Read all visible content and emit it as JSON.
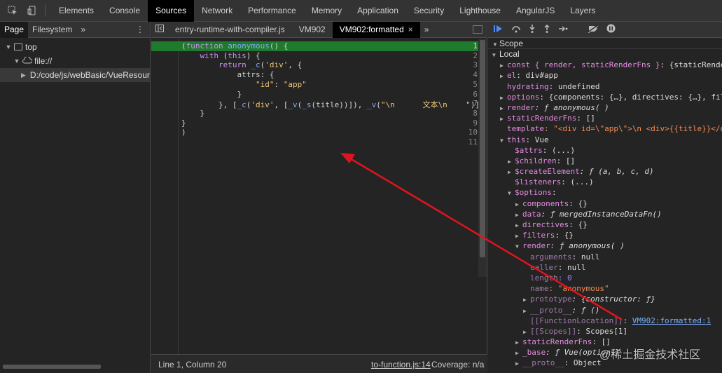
{
  "top_tabs": [
    "Elements",
    "Console",
    "Sources",
    "Network",
    "Performance",
    "Memory",
    "Application",
    "Security",
    "Lighthouse",
    "AngularJS",
    "Layers"
  ],
  "active_top_tab": "Sources",
  "navigator": {
    "tabs": [
      "Page",
      "Filesystem"
    ],
    "more": "»",
    "menu": "⋮",
    "tree": [
      {
        "label": "top",
        "arrow": "▼"
      },
      {
        "label": "file://",
        "arrow": "▼"
      },
      {
        "label": "D:/code/js/webBasic/VueResource",
        "arrow": "▶"
      }
    ]
  },
  "editor": {
    "tabs": [
      {
        "label": "entry-runtime-with-compiler.js"
      },
      {
        "label": "VM902"
      },
      {
        "label": "VM902:formatted"
      }
    ],
    "close_glyph": "×",
    "more": "»",
    "lines": [
      {
        "num": "1",
        "text": "(function anonymous() {"
      },
      {
        "num": "2",
        "text": "    with (this) {"
      },
      {
        "num": "3",
        "text": "        return _c('div', {"
      },
      {
        "num": "4",
        "text": "            attrs: {"
      },
      {
        "num": "5",
        "text": "                \"id\": \"app\""
      },
      {
        "num": "6",
        "text": "            }"
      },
      {
        "num": "7",
        "text": "        }, [_c('div', [_v(_s(title))]), _v(\"\\n      文本\\n    \")])"
      },
      {
        "num": "8",
        "text": "    }"
      },
      {
        "num": "9",
        "text": "}"
      },
      {
        "num": "10",
        "text": ")"
      },
      {
        "num": "11",
        "text": ""
      }
    ],
    "status": {
      "position": "Line 1, Column 20",
      "source_link": "to-function.js:14",
      "coverage": "Coverage: n/a"
    }
  },
  "debugger": {
    "scope_title": "Scope",
    "rows": [
      {
        "indent": 0,
        "tri": "▼",
        "key": "Local",
        "val": "",
        "header": true
      },
      {
        "indent": 1,
        "tri": "▶",
        "key": "const { render, staticRenderFns }",
        "val": ": {staticRenderFns"
      },
      {
        "indent": 1,
        "tri": "▶",
        "key": "el",
        "val": ": div#app"
      },
      {
        "indent": 1,
        "tri": "",
        "key": "hydrating",
        "val": ": undefined"
      },
      {
        "indent": 1,
        "tri": "▶",
        "key": "options",
        "val": ": {components: {…}, directives: {…}, filters"
      },
      {
        "indent": 1,
        "tri": "▶",
        "key": "render",
        "val": ": ƒ anonymous( )"
      },
      {
        "indent": 1,
        "tri": "▶",
        "key": "staticRenderFns",
        "val": ": []"
      },
      {
        "indent": 1,
        "tri": "",
        "key": "template",
        "val": ": \"<div id=\\\"app\\\">\\n      <div>{{title}}</d"
      },
      {
        "indent": 1,
        "tri": "▼",
        "key": "this",
        "val": ": Vue"
      },
      {
        "indent": 2,
        "tri": "",
        "key": "$attrs",
        "val": ": (...)"
      },
      {
        "indent": 2,
        "tri": "▶",
        "key": "$children",
        "val": ": []"
      },
      {
        "indent": 2,
        "tri": "▶",
        "key": "$createElement",
        "val": ": ƒ (a, b, c, d)"
      },
      {
        "indent": 2,
        "tri": "",
        "key": "$listeners",
        "val": ": (...)"
      },
      {
        "indent": 2,
        "tri": "▼",
        "key": "$options",
        "val": ":"
      },
      {
        "indent": 3,
        "tri": "▶",
        "key": "components",
        "val": ": {}"
      },
      {
        "indent": 3,
        "tri": "▶",
        "key": "data",
        "val": ": ƒ mergedInstanceDataFn()"
      },
      {
        "indent": 3,
        "tri": "▶",
        "key": "directives",
        "val": ": {}"
      },
      {
        "indent": 3,
        "tri": "▶",
        "key": "filters",
        "val": ": {}"
      },
      {
        "indent": 3,
        "tri": "▼",
        "key": "render",
        "val": ": ƒ anonymous( )"
      },
      {
        "indent": 4,
        "tri": "",
        "key": "arguments",
        "val": ": null",
        "dim": true
      },
      {
        "indent": 4,
        "tri": "",
        "key": "caller",
        "val": ": null",
        "dim": true
      },
      {
        "indent": 4,
        "tri": "",
        "key": "length",
        "val": ": 0",
        "dim": true
      },
      {
        "indent": 4,
        "tri": "",
        "key": "name",
        "val": ": \"anonymous\"",
        "dim": true
      },
      {
        "indent": 4,
        "tri": "▶",
        "key": "prototype",
        "val": ": {constructor: ƒ}",
        "dim": true
      },
      {
        "indent": 4,
        "tri": "▶",
        "key": "__proto__",
        "val": ": ƒ ()",
        "dim": true
      },
      {
        "indent": 4,
        "tri": "",
        "key": "[[FunctionLocation]]",
        "val": ": ",
        "link": "VM902:formatted:1",
        "dim": true
      },
      {
        "indent": 4,
        "tri": "▶",
        "key": "[[Scopes]]",
        "val": ": Scopes[1]",
        "dim": true
      },
      {
        "indent": 3,
        "tri": "▶",
        "key": "staticRenderFns",
        "val": ": []"
      },
      {
        "indent": 3,
        "tri": "▶",
        "key": "_base",
        "val": ": ƒ Vue(options)"
      },
      {
        "indent": 3,
        "tri": "▶",
        "key": "__proto__",
        "val": ": Object",
        "dim": true
      }
    ]
  },
  "watermark": "@稀土掘金技术社区",
  "colors": {
    "line_highlight": "#1f7a2e",
    "arrow": "#e0141e",
    "resume": "#4a8cff"
  }
}
